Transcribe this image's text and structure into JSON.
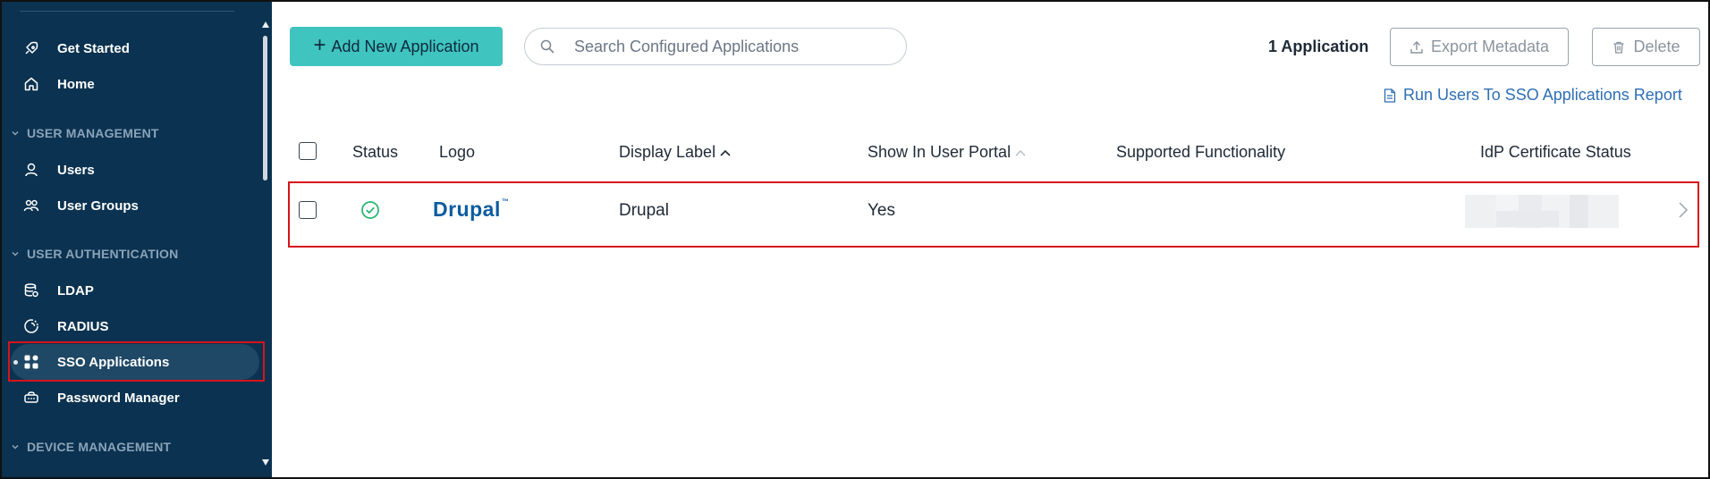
{
  "sidebar": {
    "items": [
      {
        "key": "get-started",
        "label": "Get Started",
        "icon": "rocket-icon"
      },
      {
        "key": "home",
        "label": "Home",
        "icon": "home-icon"
      },
      {
        "key": "users",
        "label": "Users",
        "icon": "user-icon"
      },
      {
        "key": "user-groups",
        "label": "User Groups",
        "icon": "user-group-icon"
      },
      {
        "key": "ldap",
        "label": "LDAP",
        "icon": "ldap-icon"
      },
      {
        "key": "radius",
        "label": "RADIUS",
        "icon": "radius-icon"
      },
      {
        "key": "sso-applications",
        "label": "SSO Applications",
        "icon": "apps-grid-icon",
        "active": true
      },
      {
        "key": "password-manager",
        "label": "Password Manager",
        "icon": "password-manager-icon"
      }
    ],
    "sections": {
      "user_management": "USER MANAGEMENT",
      "user_authentication": "USER AUTHENTICATION",
      "device_management": "DEVICE MANAGEMENT"
    }
  },
  "toolbar": {
    "add_label": "Add New Application",
    "search_placeholder": "Search Configured Applications",
    "count_label": "1 Application",
    "export_label": "Export Metadata",
    "delete_label": "Delete",
    "report_link": "Run Users To SSO Applications Report"
  },
  "table": {
    "headers": {
      "status": "Status",
      "logo": "Logo",
      "display_label": "Display Label",
      "show_in_portal": "Show In User Portal",
      "supported_functionality": "Supported Functionality",
      "idp_cert_status": "IdP Certificate Status"
    },
    "rows": [
      {
        "status": "active",
        "logo_text": "Drupal",
        "logo_tm": "™",
        "display_label": "Drupal",
        "show_in_portal": "Yes",
        "supported_functionality": ""
      }
    ]
  },
  "colors": {
    "sidebar_bg": "#0b3250",
    "accent": "#40c4c0",
    "link": "#2e6fb3",
    "status_ok": "#2bb673",
    "annotation": "#d7141a",
    "drupal_blue": "#0d5c9e"
  }
}
